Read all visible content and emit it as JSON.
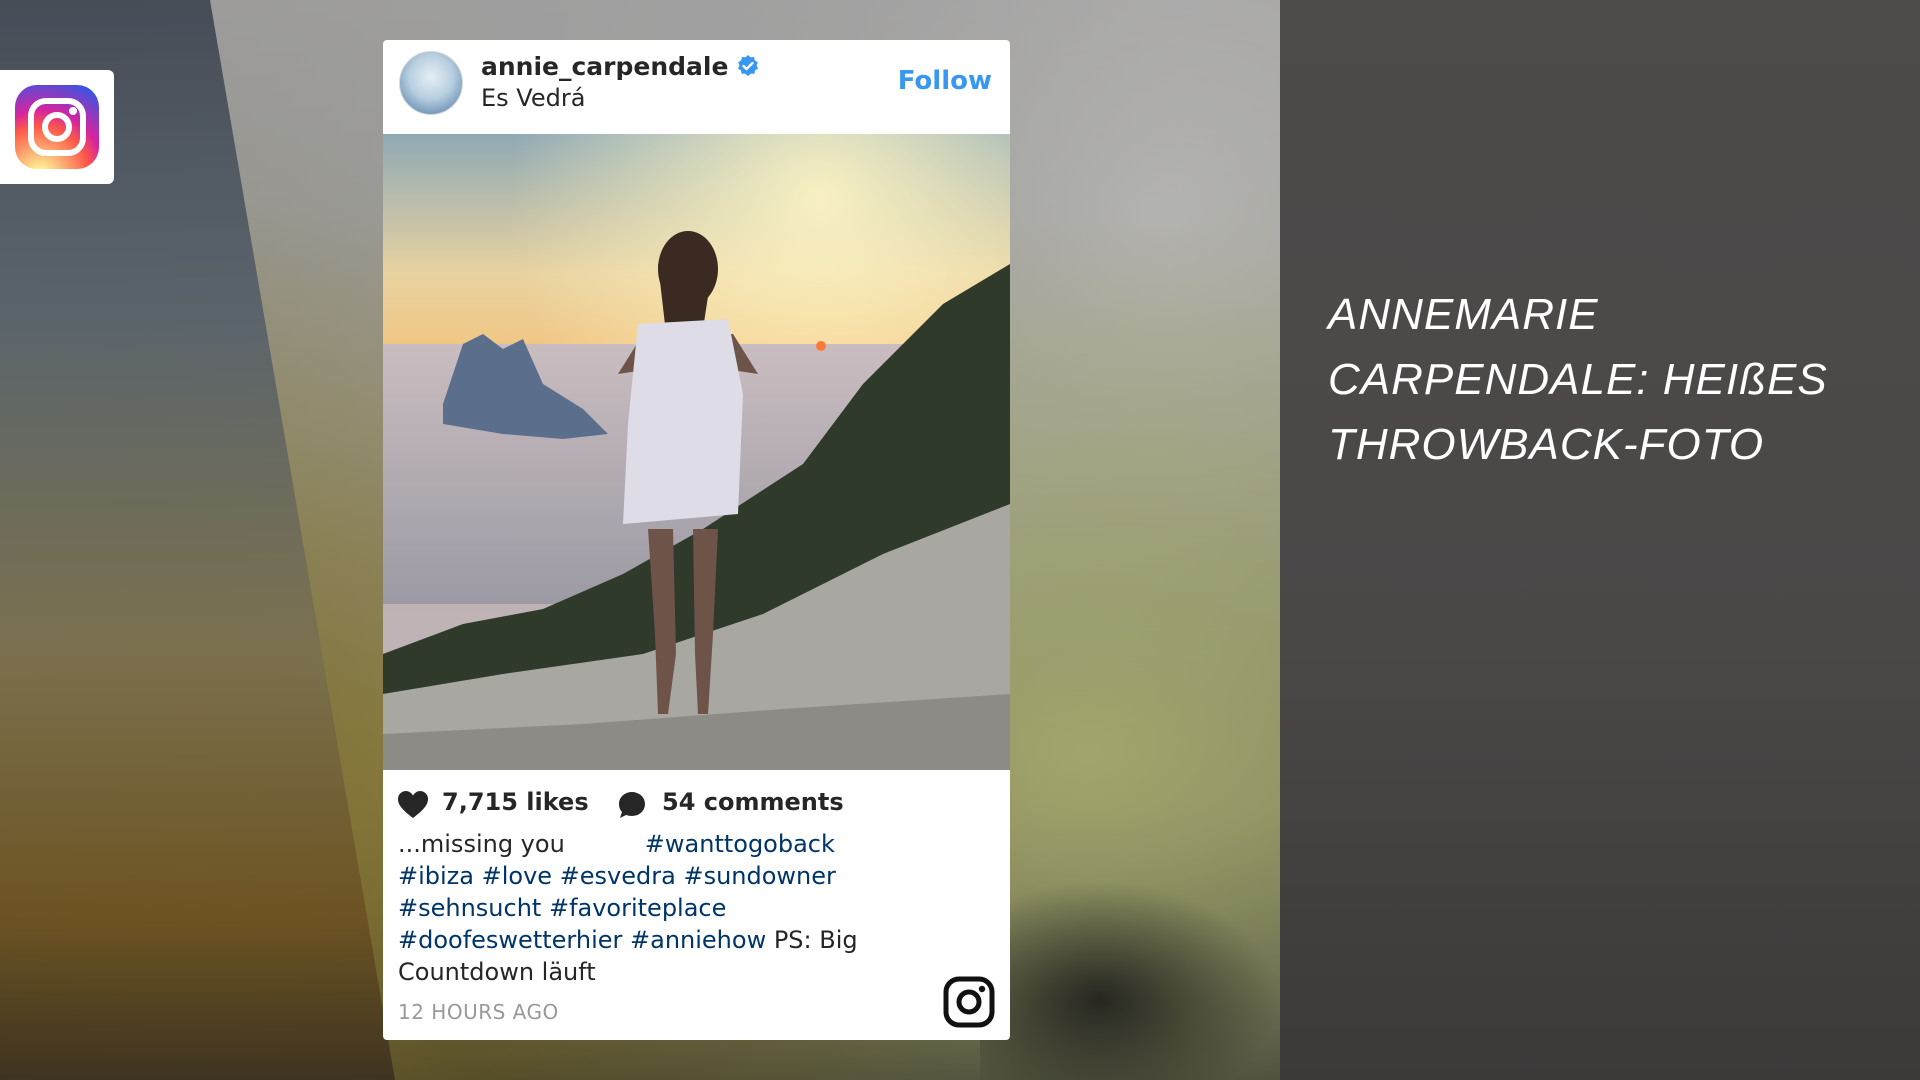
{
  "headline": [
    "ANNEMARIE",
    "CARPENDALE: HEIßES",
    "THROWBACK-FOTO"
  ],
  "post": {
    "username": "annie_carpendale",
    "location": "Es Vedrá",
    "follow_label": "Follow",
    "likes": "7,715 likes",
    "comments": "54 comments",
    "caption": {
      "text_start": "...missing you",
      "tags_line1": "#wanttogoback",
      "tags_line2": "#ibiza #love #esvedra #sundowner",
      "tags_line3": "#sehnsucht #favoriteplace",
      "tags_line4": "#doofeswetterhier #anniehow",
      "text_end": " PS: Big",
      "text_last": "Countdown läuft"
    },
    "timestamp": "12 HOURS AGO"
  },
  "icons": {
    "instagram_badge": "instagram-logo-icon",
    "verified": "verified-badge-icon",
    "like": "heart-icon",
    "comment": "comment-bubble-icon",
    "brand": "instagram-glyph-icon"
  },
  "colors": {
    "follow": "#3897f0",
    "hashtag": "#003569",
    "panel": "#4a4747"
  }
}
